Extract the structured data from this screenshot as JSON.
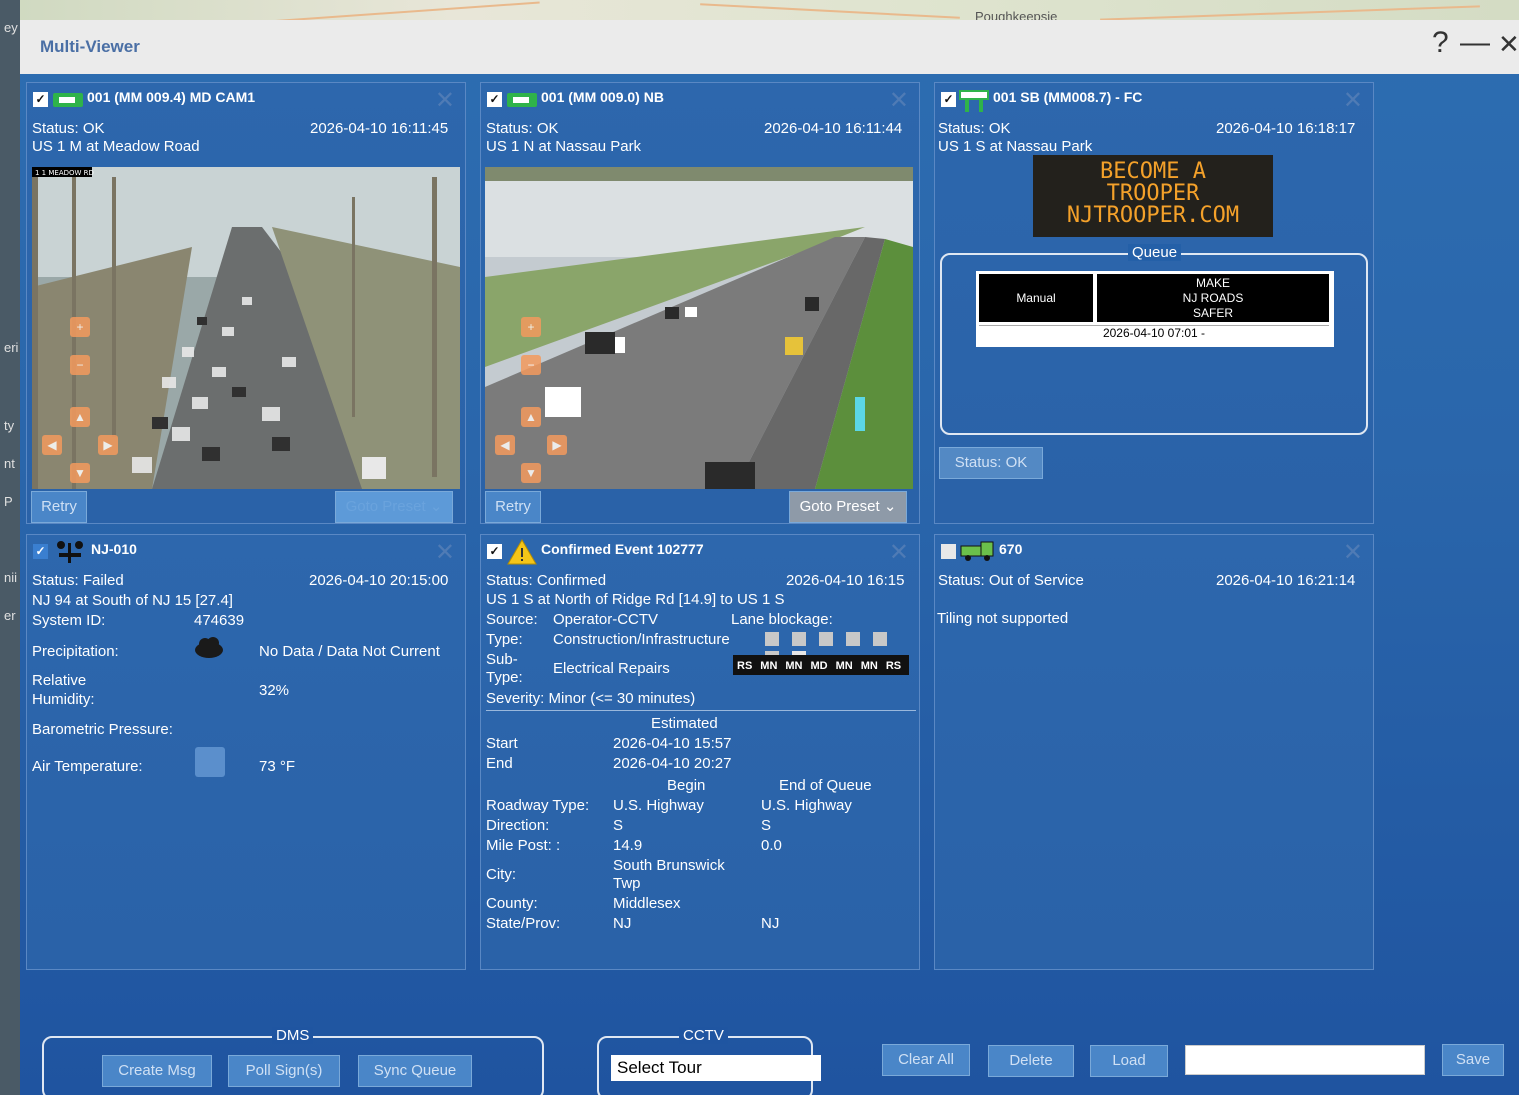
{
  "window": {
    "title": "Multi-Viewer",
    "help": "?",
    "minimize": "—",
    "close": "✕"
  },
  "map": {
    "city": "Poughkeepsie"
  },
  "leftstrip": [
    "ey",
    "eri",
    "ty",
    "nt",
    "P",
    "nii",
    "er"
  ],
  "cam1": {
    "checked": "✓",
    "title": "001 (MM 009.4) MD CAM1",
    "status": "Status: OK",
    "timestamp": "2026-04-10 16:11:45",
    "location": "US 1 M at Meadow Road",
    "retry": "Retry",
    "preset": "Goto Preset",
    "overlay": "1 1 MEADOW RD"
  },
  "cam2": {
    "checked": "✓",
    "title": "001 (MM 009.0) NB",
    "status": "Status: OK",
    "timestamp": "2026-04-10 16:11:44",
    "location": "US 1 N at Nassau Park",
    "retry": "Retry",
    "preset": "Goto Preset"
  },
  "dms": {
    "checked": "✓",
    "title": "001 SB (MM008.7) - FC",
    "status": "Status: OK",
    "timestamp": "2026-04-10 16:18:17",
    "location": "US 1 S at Nassau Park",
    "sign_lines": [
      "BECOME A",
      "TROOPER",
      "NJTROOPER.COM"
    ],
    "queue_label": "Queue",
    "queue_mode": "Manual",
    "queue_msg": [
      "MAKE",
      "NJ ROADS",
      "SAFER"
    ],
    "queue_time": "2026-04-10 07:01 -",
    "status_btn": "Status: OK"
  },
  "rwis": {
    "checked": "✓",
    "title": "NJ-010",
    "status": "Status: Failed",
    "timestamp": "2026-04-10 20:15:00",
    "location": "NJ 94 at South of NJ 15 [27.4]",
    "sysid_label": "System ID:",
    "sysid": "474639",
    "precip_label": "Precipitation:",
    "precip_val": "No Data / Data Not Current",
    "humidity_label1": "Relative",
    "humidity_label2": "Humidity:",
    "humidity_val": "32%",
    "pressure_label": "Barometric Pressure:",
    "temp_label": "Air Temperature:",
    "temp_val": "73 °F"
  },
  "event": {
    "checked": "✓",
    "title": "Confirmed Event 102777",
    "status": "Status: Confirmed",
    "timestamp": "2026-04-10 16:15",
    "location": "US 1 S at North of Ridge Rd [14.9] to US 1 S",
    "source_label": "Source:",
    "source": "Operator-CCTV",
    "lane_label": "Lane blockage:",
    "type_label": "Type:",
    "type": "Construction/Infrastructure",
    "sub1": "Sub-",
    "sub2": "Type:",
    "subtype": "Electrical Repairs",
    "lanes": [
      "RS",
      "MN",
      "MN",
      "MD",
      "MN",
      "MN",
      "RS"
    ],
    "severity": "Severity: Minor (<= 30 minutes)",
    "estimated": "Estimated",
    "start_label": "Start",
    "start": "2026-04-10 15:57",
    "end_label": "End",
    "end": "2026-04-10 20:27",
    "begin_h": "Begin",
    "eoq_h": "End of Queue",
    "rt_label": "Roadway Type:",
    "rt_b": "U.S. Highway",
    "rt_e": "U.S. Highway",
    "dir_label": "Direction:",
    "dir_b": "S",
    "dir_e": "S",
    "mp_label": "Mile Post: :",
    "mp_b": "14.9",
    "mp_e": "0.0",
    "city_label": "City:",
    "city_b1": "South Brunswick",
    "city_b2": "Twp",
    "county_label": "County:",
    "county_b": "Middlesex",
    "state_label": "State/Prov:",
    "state_b": "NJ",
    "state_e": "NJ"
  },
  "vehicle": {
    "title": "670",
    "status": "Status: Out of Service",
    "timestamp": "2026-04-10 16:21:14",
    "note": "Tiling not supported"
  },
  "footer": {
    "dms_label": "DMS",
    "create": "Create Msg",
    "poll": "Poll Sign(s)",
    "sync": "Sync Queue",
    "cctv_label": "CCTV",
    "tour": "Select Tour",
    "clear": "Clear All",
    "delete": "Delete",
    "load": "Load",
    "name_value": "",
    "save": "Save"
  }
}
